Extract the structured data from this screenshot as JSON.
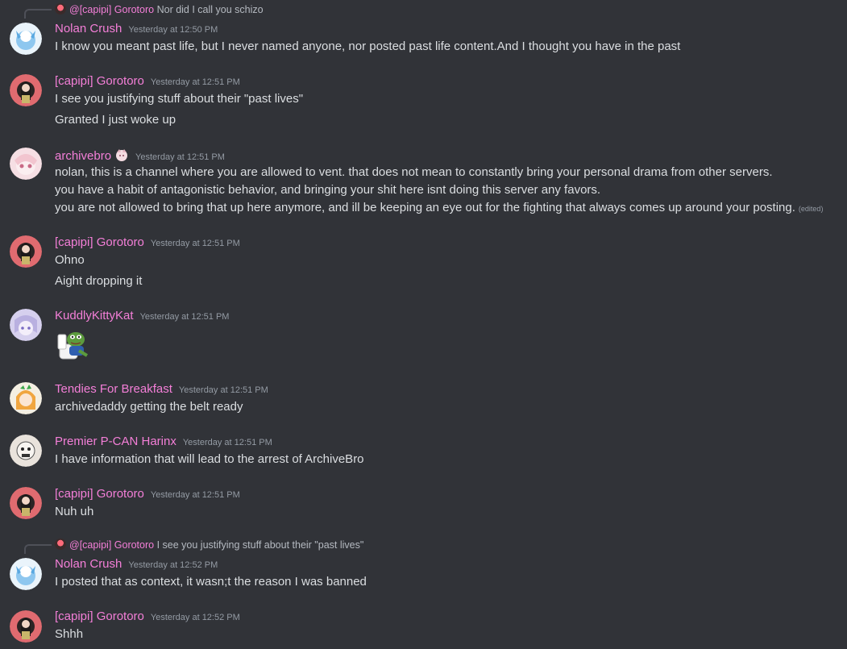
{
  "colors": {
    "background": "#313338",
    "username": "#f47fd8",
    "text": "#dbdee1",
    "timestamp": "#949ba4"
  },
  "messages": [
    {
      "reply": {
        "name": "@[capipi] Gorotoro",
        "text": "Nor did I call you schizo"
      },
      "author": "Nolan Crush",
      "time": "Yesterday at 12:50 PM",
      "lines": [
        "I know you meant past life, but I never named anyone, nor posted past life content.And I thought you have in the past"
      ]
    },
    {
      "author": "[capipi] Gorotoro",
      "time": "Yesterday at 12:51 PM",
      "lines": [
        "I see you justifying stuff about their \"past lives\"",
        "Granted I just woke up"
      ]
    },
    {
      "author": "archivebro",
      "time": "Yesterday at 12:51 PM",
      "lines": [
        "nolan, this is a channel where you are allowed to vent. that does not mean to constantly bring your personal drama from other servers.",
        "you have a habit of antagonistic behavior, and bringing your shit here isnt doing this server any favors.",
        "you are not allowed to bring that up here anymore, and ill be keeping an eye out for the fighting that always comes up around your posting."
      ],
      "edited": "(edited)"
    },
    {
      "author": "[capipi] Gorotoro",
      "time": "Yesterday at 12:51 PM",
      "lines": [
        "Ohno",
        "Aight dropping it"
      ]
    },
    {
      "author": "KuddlyKittyKat",
      "time": "Yesterday at 12:51 PM",
      "sticker": "pepe-toilet-sticker"
    },
    {
      "author": "Tendies For Breakfast",
      "time": "Yesterday at 12:51 PM",
      "lines": [
        "archivedaddy getting the belt ready"
      ]
    },
    {
      "author": "Premier P-CAN Harinx",
      "time": "Yesterday at 12:51 PM",
      "lines": [
        "I have information that will lead to the arrest of ArchiveBro"
      ]
    },
    {
      "author": "[capipi] Gorotoro",
      "time": "Yesterday at 12:51 PM",
      "lines": [
        "Nuh uh"
      ]
    },
    {
      "reply": {
        "name": "@[capipi] Gorotoro",
        "text": "I see you justifying stuff about their \"past lives\""
      },
      "author": "Nolan Crush",
      "time": "Yesterday at 12:52 PM",
      "lines": [
        "I posted that as context, it wasn;t the reason I was banned"
      ]
    },
    {
      "author": "[capipi] Gorotoro",
      "time": "Yesterday at 12:52 PM",
      "lines": [
        "Shhh"
      ]
    }
  ]
}
